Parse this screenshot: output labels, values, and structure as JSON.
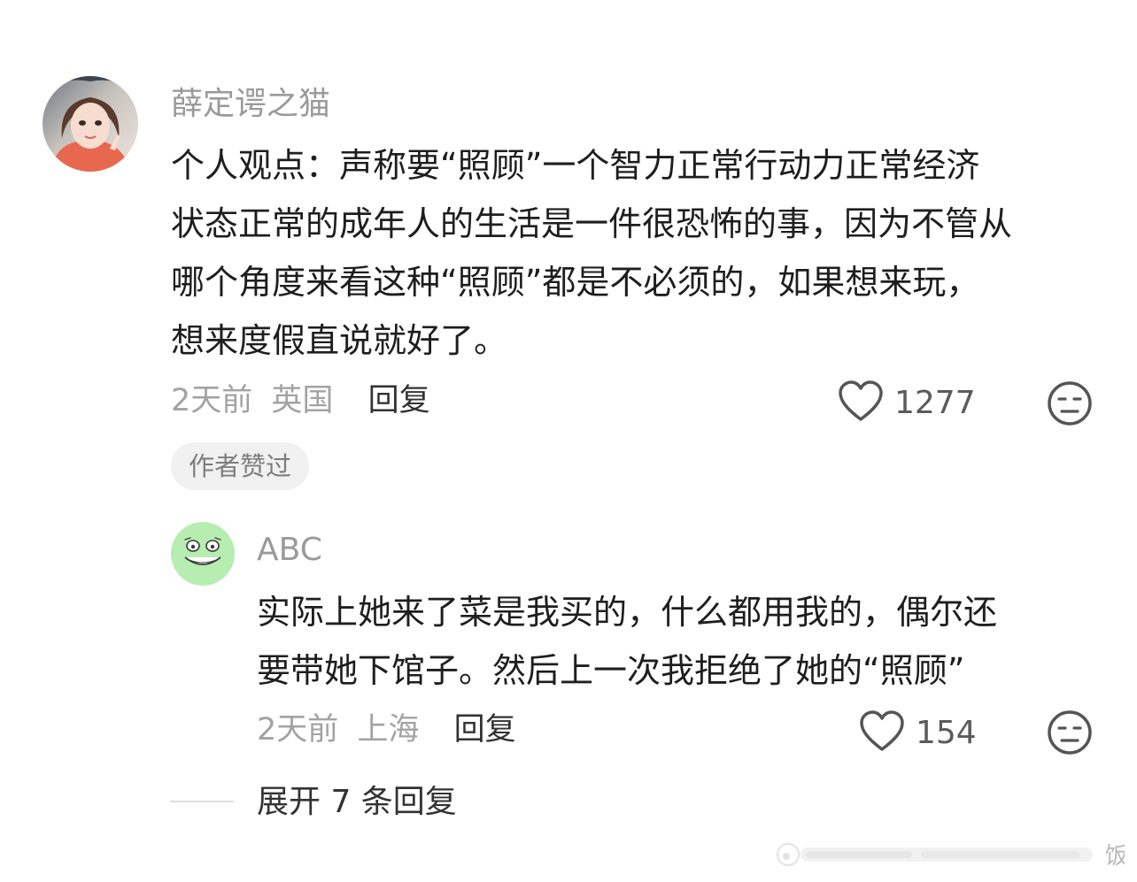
{
  "comment": {
    "username": "薛定谔之猫",
    "lines": [
      "个人观点：声称要“照顾”一个智力正常行动力正常经济",
      "状态正常的成年人的生活是一件很恐怖的事，因为不管从",
      "哪个角度来看这种“照顾”都是不必须的，如果想来玩，",
      "想来度假直说就好了。"
    ],
    "time": "2天前",
    "location": "英国",
    "reply_label": "回复",
    "like_count": "1277",
    "badge": "作者赞过"
  },
  "reply": {
    "username": "ABC",
    "lines": [
      "实际上她来了菜是我买的，什么都用我的，偶尔还",
      "要带她下馆子。然后上一次我拒绝了她的“照顾”"
    ],
    "time": "2天前",
    "location": "上海",
    "reply_label": "回复",
    "like_count": "154"
  },
  "expand": {
    "label": "展开 7 条回复"
  },
  "watermark": {
    "text": "饭"
  },
  "icons": {
    "like": "heart-outline-icon",
    "dislike": "meh-face-icon"
  },
  "colors": {
    "meta_gray": "#a3a3a3",
    "reply_avatar_bg": "#b7edb0"
  }
}
